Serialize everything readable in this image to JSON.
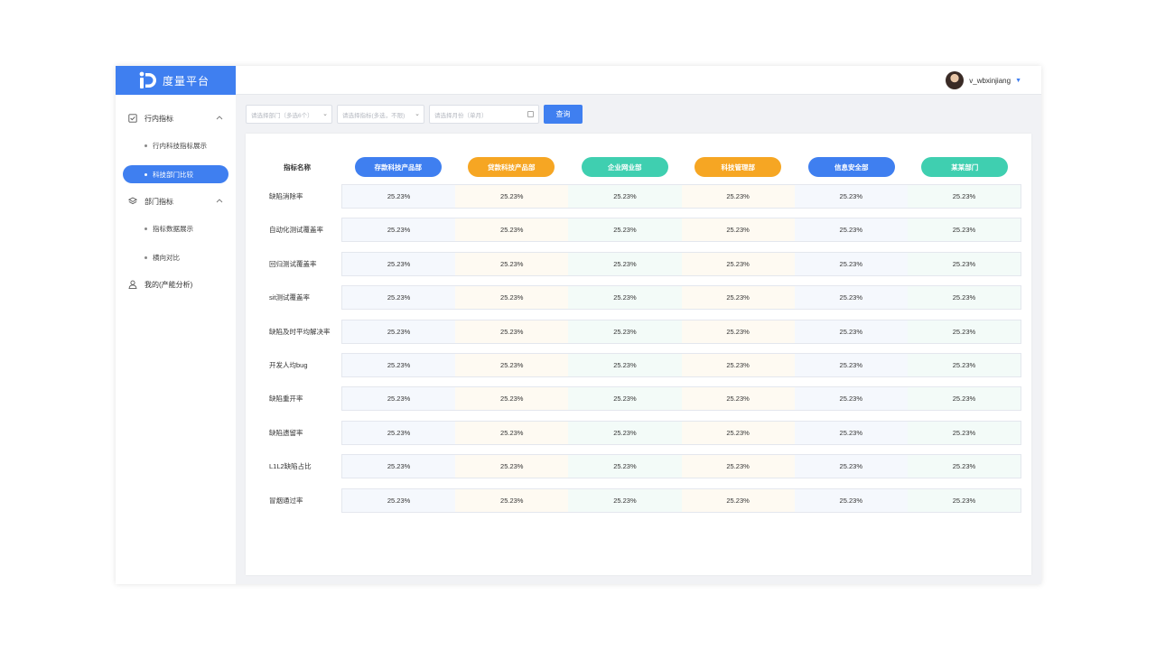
{
  "app": {
    "title": "度量平台",
    "brand_color": "#3f7ff0"
  },
  "topbar": {
    "username": "v_wbxinjiang",
    "caret_icon": "caret-down-icon"
  },
  "sidebar": {
    "groups": [
      {
        "label": "行内指标",
        "icon": "checkbox-icon",
        "expanded": true,
        "items": [
          {
            "label": "行内科技指标展示",
            "active": false
          },
          {
            "label": "科技部门比较",
            "active": true
          }
        ]
      },
      {
        "label": "部门指标",
        "icon": "layers-icon",
        "expanded": true,
        "items": [
          {
            "label": "指标数据展示",
            "active": false
          },
          {
            "label": "横向对比",
            "active": false
          }
        ]
      },
      {
        "label": "我的(产能分析)",
        "icon": "user-icon",
        "expanded": false,
        "items": []
      }
    ]
  },
  "filters": {
    "department_placeholder": "请选择部门（多选6个）",
    "indicator_placeholder": "请选择指标(多选，不限)",
    "month_placeholder": "请选择月份（单月）",
    "query_label": "查询"
  },
  "table": {
    "name_header": "指标名称",
    "departments": [
      {
        "name": "存款科技产品部",
        "color": "#3f7ff0",
        "tint": "#f5f8fd"
      },
      {
        "name": "贷款科技产品部",
        "color": "#f6a623",
        "tint": "#fefaf2"
      },
      {
        "name": "企业网业部",
        "color": "#3fcfb0",
        "tint": "#f3fbf8"
      },
      {
        "name": "科技管理部",
        "color": "#f6a623",
        "tint": "#fefaf2"
      },
      {
        "name": "信息安全部",
        "color": "#3f7ff0",
        "tint": "#f5f8fd"
      },
      {
        "name": "某某部门",
        "color": "#3fcfb0",
        "tint": "#f3fbf8"
      }
    ],
    "rows": [
      {
        "label": "缺陷消除率",
        "values": [
          "25.23%",
          "25.23%",
          "25.23%",
          "25.23%",
          "25.23%",
          "25.23%"
        ]
      },
      {
        "label": "自动化测试覆盖率",
        "values": [
          "25.23%",
          "25.23%",
          "25.23%",
          "25.23%",
          "25.23%",
          "25.23%"
        ]
      },
      {
        "label": "回归测试覆盖率",
        "values": [
          "25.23%",
          "25.23%",
          "25.23%",
          "25.23%",
          "25.23%",
          "25.23%"
        ]
      },
      {
        "label": "sit测试覆盖率",
        "values": [
          "25.23%",
          "25.23%",
          "25.23%",
          "25.23%",
          "25.23%",
          "25.23%"
        ]
      },
      {
        "label": "缺陷及时平均解决率",
        "values": [
          "25.23%",
          "25.23%",
          "25.23%",
          "25.23%",
          "25.23%",
          "25.23%"
        ]
      },
      {
        "label": "开发人均bug",
        "values": [
          "25.23%",
          "25.23%",
          "25.23%",
          "25.23%",
          "25.23%",
          "25.23%"
        ]
      },
      {
        "label": "缺陷重开率",
        "values": [
          "25.23%",
          "25.23%",
          "25.23%",
          "25.23%",
          "25.23%",
          "25.23%"
        ]
      },
      {
        "label": "缺陷遗留率",
        "values": [
          "25.23%",
          "25.23%",
          "25.23%",
          "25.23%",
          "25.23%",
          "25.23%"
        ]
      },
      {
        "label": "L1L2缺陷占比",
        "values": [
          "25.23%",
          "25.23%",
          "25.23%",
          "25.23%",
          "25.23%",
          "25.23%"
        ]
      },
      {
        "label": "冒烟通过率",
        "values": [
          "25.23%",
          "25.23%",
          "25.23%",
          "25.23%",
          "25.23%",
          "25.23%"
        ]
      }
    ]
  }
}
